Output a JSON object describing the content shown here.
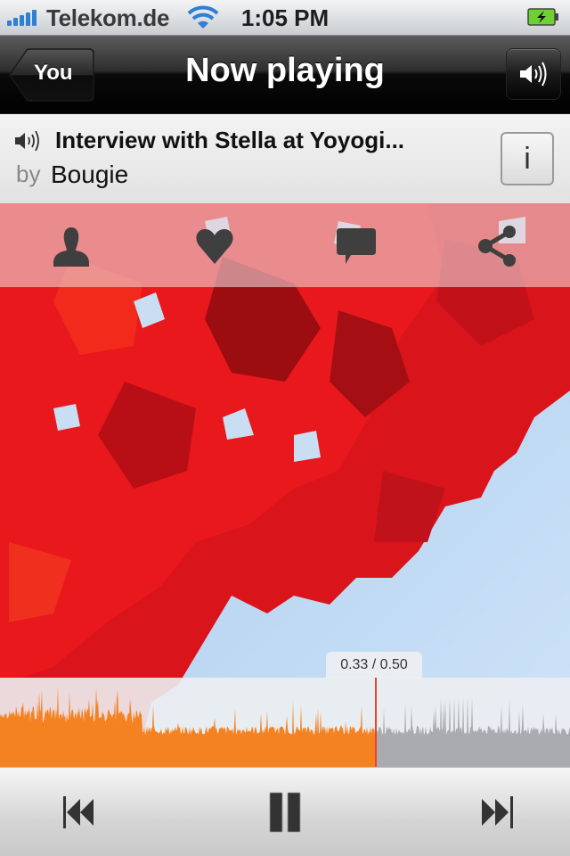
{
  "status_bar": {
    "carrier": "Telekom.de",
    "time": "1:05 PM",
    "signal_bars": 5,
    "wifi_icon": "wifi-icon",
    "battery_icon": "battery-charging-icon",
    "battery_state": "charging"
  },
  "nav": {
    "back_label": "You",
    "title": "Now playing",
    "volume_icon": "speaker-icon"
  },
  "track": {
    "title": "Interview with Stella at Yoyogi...",
    "by_label": "by",
    "artist": "Bougie",
    "info_label": "i",
    "playing_icon": "speaker-icon"
  },
  "actions": [
    {
      "name": "profile",
      "icon": "user-icon"
    },
    {
      "name": "like",
      "icon": "heart-icon"
    },
    {
      "name": "comment",
      "icon": "comment-icon"
    },
    {
      "name": "share",
      "icon": "share-icon"
    }
  ],
  "player": {
    "position_label": "0.33 / 0.50",
    "current": "0.33",
    "duration": "0.50",
    "progress_fraction": 0.66,
    "played_color": "#f58220",
    "unplayed_color": "#a9abb0",
    "playhead_color": "#e8452a"
  },
  "controls": {
    "previous_icon": "skip-back-icon",
    "pause_icon": "pause-icon",
    "next_icon": "skip-forward-icon"
  }
}
